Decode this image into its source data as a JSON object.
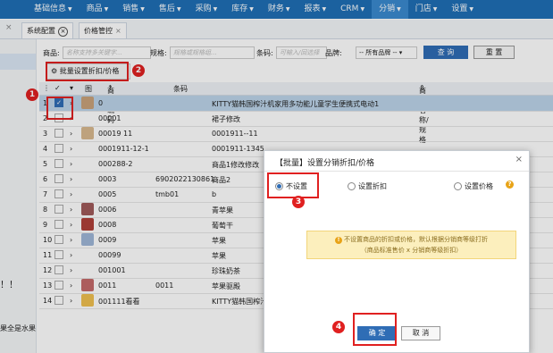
{
  "nav": {
    "items": [
      "基础信息",
      "商品",
      "销售",
      "售后",
      "采购",
      "库存",
      "财务",
      "报表",
      "CRM",
      "分销",
      "门店",
      "设置"
    ],
    "active": "分销",
    "accent": "#1f6fb5"
  },
  "tabs": [
    "系统配置",
    "价格管控"
  ],
  "sidebar": {
    "text1": "！！",
    "text2": "果全是水果"
  },
  "filters": {
    "product_label": "商品:",
    "product_placeholder": "名称支持多关键字...",
    "spec_label": "规格:",
    "spec_placeholder": "规格或规格组...",
    "barcode_label": "条码:",
    "barcode_placeholder": "可输入/回选择",
    "brand_label": "品牌:",
    "brand_value": "-- 所有品牌 --",
    "search_button": "查 询",
    "reset_button": "重 置"
  },
  "batch_button": "批量设置折扣/价格",
  "table": {
    "headers": [
      "图",
      "商品编码",
      "条码",
      "商品名称/规格"
    ],
    "rows": [
      {
        "num": "1",
        "code": "0",
        "barcode": "",
        "name": "KITTY猫韩国榨汁机家用多功能儿童学生便携式电动1",
        "checked": true
      },
      {
        "num": "2",
        "code": "00001",
        "barcode": "",
        "name": "裙子修改",
        "checked": false
      },
      {
        "num": "3",
        "code": "00019 11",
        "barcode": "",
        "name": "0001911--11",
        "checked": false
      },
      {
        "num": "4",
        "code": "0001911-12-1",
        "barcode": "",
        "name": "0001911-1345",
        "checked": false
      },
      {
        "num": "5",
        "code": "000288-2",
        "barcode": "",
        "name": "商品1修改修改",
        "checked": false
      },
      {
        "num": "6",
        "code": "0003",
        "barcode": "6902022130861",
        "name": "商品2",
        "checked": false
      },
      {
        "num": "7",
        "code": "0005",
        "barcode": "tmb01",
        "name": "b",
        "checked": false
      },
      {
        "num": "8",
        "code": "0006",
        "barcode": "",
        "name": "青苹果",
        "checked": false
      },
      {
        "num": "9",
        "code": "0008",
        "barcode": "",
        "name": "葡萄干",
        "checked": false
      },
      {
        "num": "10",
        "code": "0009",
        "barcode": "",
        "name": "苹果",
        "checked": false
      },
      {
        "num": "11",
        "code": "00099",
        "barcode": "",
        "name": "苹果",
        "checked": false
      },
      {
        "num": "12",
        "code": "001001",
        "barcode": "",
        "name": "珍珠奶茶",
        "checked": false
      },
      {
        "num": "13",
        "code": "0011",
        "barcode": "0011",
        "name": "苹果驱殿",
        "checked": false
      },
      {
        "num": "14",
        "code": "001111看看",
        "barcode": "",
        "name": "KITTY猫韩国榨汁",
        "checked": false
      }
    ]
  },
  "dialog": {
    "title": "【批量】设置分销折扣/价格",
    "close": "×",
    "options": [
      "不设置",
      "设置折扣",
      "设置价格"
    ],
    "selected": "不设置",
    "help": "?",
    "warning_line1": "不设置商品的折扣或价格，默认根据分销商等级打折",
    "warning_line2": "（商品标准售价 x 分销商等级折扣）",
    "confirm": "确 定",
    "cancel": "取 消"
  },
  "annotations": [
    "1",
    "2",
    "3",
    "4"
  ],
  "colors": {
    "highlight_red": "#e02020",
    "selected_row": "#bcd4ea"
  }
}
